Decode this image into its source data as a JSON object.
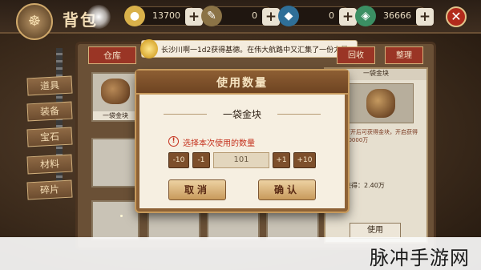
{
  "header": {
    "emblem_glyph": "☸",
    "title": "背包"
  },
  "resources": [
    {
      "icon": "coin-icon",
      "value": "13700",
      "color": "#d9b14a"
    },
    {
      "icon": "feather-icon",
      "value": "0",
      "color": "#c7a45a"
    },
    {
      "icon": "diamond-icon",
      "value": "0",
      "color": "#5fb7e4"
    },
    {
      "icon": "gem-icon",
      "value": "36666",
      "color": "#6fcf97"
    }
  ],
  "close_glyph": "✕",
  "tabs": {
    "storage": "仓库",
    "right_1": "回收",
    "right_2": "整理"
  },
  "news": "长沙川啊一1d2获得基德。在伟大航路中又汇集了一份力量",
  "categories": [
    "道具",
    "装备",
    "宝石",
    "材料",
    "碎片"
  ],
  "grid": {
    "first_item_label": "一袋金块"
  },
  "detail": {
    "header": "一袋金块",
    "text": "打开后可获得金块，开启获得10000万",
    "gold": "获得：2.40万",
    "use_button": "使用"
  },
  "dialog": {
    "title": "使用数量",
    "item_name": "一袋金块",
    "warning_icon": "!",
    "prompt": "选择本次使用的数量",
    "buttons": {
      "minus10": "-10",
      "minus1": "-1",
      "plus1": "+1",
      "plus10": "+10"
    },
    "quantity": "101",
    "cancel": "取消",
    "confirm": "确认"
  },
  "watermark": "脉冲手游网"
}
